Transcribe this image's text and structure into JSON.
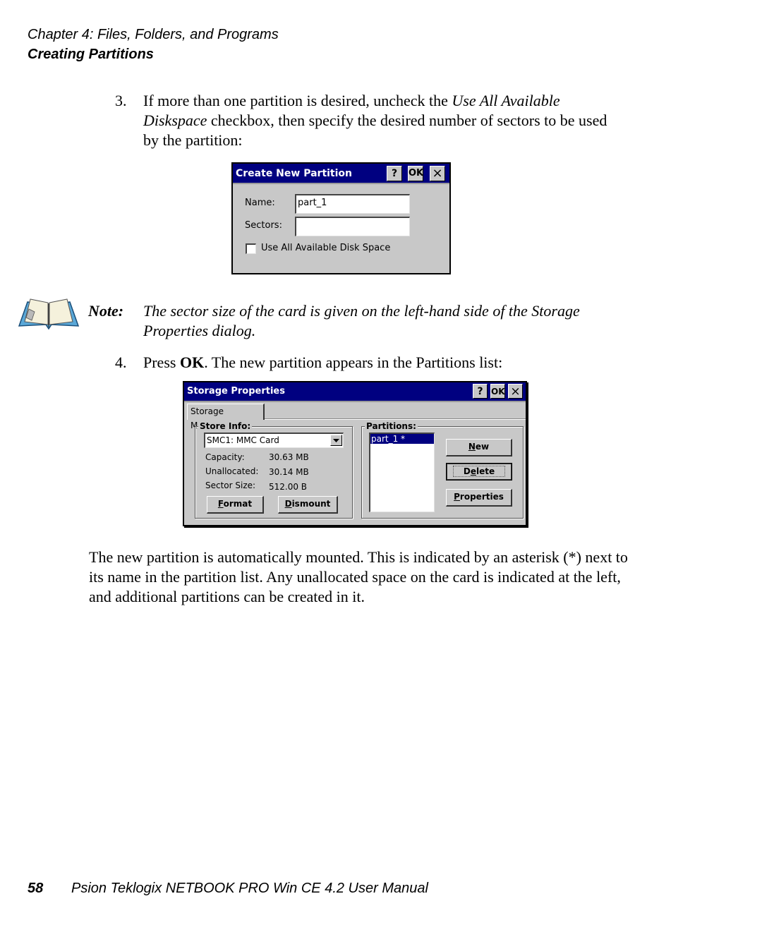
{
  "header": {
    "chapter": "Chapter 4:  Files, Folders, and Programs",
    "section": "Creating Partitions"
  },
  "step3": {
    "number": "3.",
    "text_before": "If more than one partition is desired, uncheck the ",
    "emphasis": "Use All Available Diskspace",
    "text_after": " checkbox, then specify the desired number of sectors to be used by the partition:"
  },
  "create_dialog": {
    "title": "Create New Partition",
    "help_button": "?",
    "ok_button": "OK",
    "close_button": "×",
    "name_label": "Name:",
    "name_value": "part_1",
    "sectors_label": "Sectors:",
    "sectors_value": "",
    "checkbox_label": "Use All Available Disk Space",
    "checkbox_checked": false
  },
  "note": {
    "icon": "open-book-icon",
    "label": "Note:",
    "text": "The sector size of the card is given on the left-hand side of the Storage Properties dialog."
  },
  "step4": {
    "number": "4.",
    "text_before": "Press ",
    "bold": "OK",
    "text_after": ". The new partition appears in the Partitions list:"
  },
  "storage_dialog": {
    "title": "Storage Properties",
    "help_button": "?",
    "ok_button": "OK",
    "close_button": "×",
    "tab": "Storage Manager",
    "store_info": {
      "group_title": "Store Info:",
      "selected_store": "SMC1: MMC Card",
      "rows": [
        {
          "label": "Capacity:",
          "value": "30.63 MB"
        },
        {
          "label": "Unallocated:",
          "value": "30.14 MB"
        },
        {
          "label": "Sector Size:",
          "value": "512.00 B"
        }
      ],
      "format_button": {
        "mnemonic": "F",
        "rest": "ormat"
      },
      "dismount_button": {
        "mnemonic": "D",
        "rest": "ismount"
      }
    },
    "partitions": {
      "group_title": "Partitions:",
      "items": [
        "part_1 *"
      ],
      "selected_index": 0,
      "new_button": {
        "mnemonic": "N",
        "rest": "ew"
      },
      "delete_button": {
        "pre": "D",
        "mnemonic": "e",
        "rest": "lete"
      },
      "properties_button": {
        "mnemonic": "P",
        "rest": "roperties"
      }
    }
  },
  "paragraph": "The new partition is automatically mounted. This is indicated by an asterisk (*) next to its name in the partition list. Any unallocated space on the card is indicated at the left, and additional partitions can be created in it.",
  "footer": {
    "page_number": "58",
    "manual_title": "Psion Teklogix NETBOOK PRO Win CE 4.2 User Manual"
  },
  "colors": {
    "titlebar": "#000080",
    "dialog_bg": "#c8c8c8",
    "selection": "#000080"
  }
}
